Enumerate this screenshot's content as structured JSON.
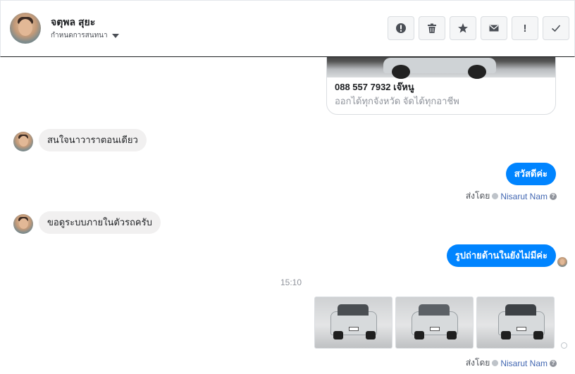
{
  "header": {
    "contact_name": "จตุพล สุยะ",
    "contact_sub": "กำหนดการสนทนา",
    "toolbar": [
      {
        "icon": "alert-circle-icon",
        "glyph": "!"
      },
      {
        "icon": "trash-icon",
        "glyph": ""
      },
      {
        "icon": "star-icon",
        "glyph": "★"
      },
      {
        "icon": "mail-icon",
        "glyph": ""
      },
      {
        "icon": "exclamation-icon",
        "glyph": "!"
      },
      {
        "icon": "check-icon",
        "glyph": "✓"
      }
    ]
  },
  "card": {
    "title": "088 557 7932 เจ๊หนู",
    "subtitle": "ออกได้ทุกจังหวัด จัดได้ทุกอาชีพ"
  },
  "messages": [
    {
      "direction": "in",
      "text": "สนใจนาวาราตอนเดียว"
    },
    {
      "direction": "out",
      "text": "สวัสดีค่ะ"
    },
    {
      "direction": "in",
      "text": "ขอดูระบบภายในตัวรถครับ"
    },
    {
      "direction": "out",
      "text": "รูปถ่ายด้านในยังไม่มีค่ะ"
    }
  ],
  "sent_by": {
    "prefix": "ส่งโดย",
    "name": "Nisarut Nam",
    "help": "?"
  },
  "timestamp": "15:10",
  "colors": {
    "accent": "#0084ff",
    "incoming_bubble": "#f1f0f0",
    "link": "#4267b2"
  }
}
